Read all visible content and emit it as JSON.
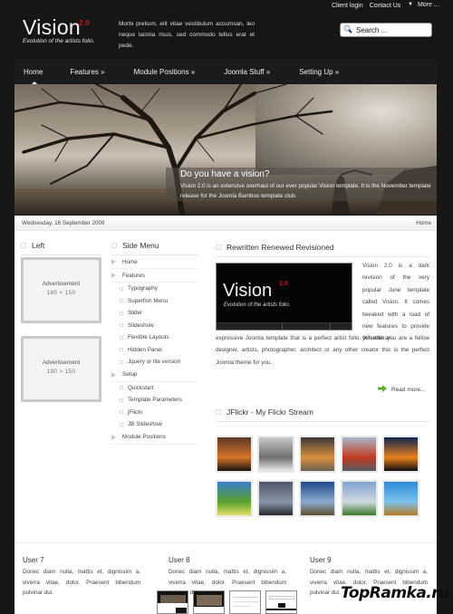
{
  "header": {
    "top_links": [
      "Client login",
      "Contact Us"
    ],
    "more_label": "More ...",
    "logo": {
      "name": "Vision",
      "version": "2.0",
      "tagline": "Evolution of the artists folio."
    },
    "intro": "Morbi pretium, elit vitae vestibulum accumsan, leo neque lacinia risus, sed commodo tellus erat et pede.",
    "search_placeholder": "Search ..."
  },
  "nav": {
    "items": [
      "Home",
      "Features »",
      "Module Positions »",
      "Joomla Stuff »",
      "Setting Up »"
    ],
    "active": "Home"
  },
  "hero": {
    "title": "Do you have a vision?",
    "text": "Vision 2.0 is an extensive overhaul of our ever popular Vision template. It is the November template release for the Joomla Bamboo template club."
  },
  "datebar": {
    "date": "Wednesday, 16 September 2009",
    "breadcrumb": "Home"
  },
  "left": {
    "title": "Left",
    "ads": [
      {
        "label": "Advertisement",
        "size": "180   ×   150"
      },
      {
        "label": "Advertisement",
        "size": "180   ×   150"
      }
    ]
  },
  "side_menu": {
    "title": "Side Menu",
    "items": [
      {
        "label": "Home",
        "level": 1
      },
      {
        "label": "Features",
        "level": 1
      },
      {
        "label": "Typography",
        "level": 2
      },
      {
        "label": "Superfish Menu",
        "level": 2
      },
      {
        "label": "Slider",
        "level": 2
      },
      {
        "label": "Slideshow",
        "level": 2
      },
      {
        "label": "Flexible Layouts",
        "level": 2
      },
      {
        "label": "Hidden Panel",
        "level": 2
      },
      {
        "label": "Jquery or lite version",
        "level": 2
      },
      {
        "label": "Setup",
        "level": 1
      },
      {
        "label": "Quickstart",
        "level": 2
      },
      {
        "label": "Template Parameters",
        "level": 2
      },
      {
        "label": "jFlickr",
        "level": 2
      },
      {
        "label": "JB Slideshow",
        "level": 2
      },
      {
        "label": "Module Positions",
        "level": 1
      }
    ]
  },
  "article": {
    "title": "Rewritten Renewed Revisioned",
    "image": {
      "name": "Vision",
      "version": "2.0",
      "tagline": "Evolution of the artists folio."
    },
    "side_text": "Vision 2.0 is a dark revision of the very popular June template called Vision. It comes tweaked with a load of new features to provide you with an",
    "full_text": "expressive Joomla template that is a perfect artist folio. Whether you are a fellow designer, artists, photographer, architect or any other creator this is the perfect Joomla theme for you.",
    "read_more": "Read more..."
  },
  "flickr": {
    "title": "JFlickr - My Flickr Stream",
    "thumbs": [
      {
        "name": "tree-silhouette-sunset",
        "colors": [
          "#5a3a24",
          "#d7742a",
          "#1a1410"
        ]
      },
      {
        "name": "bw-house",
        "colors": [
          "#c8c8c8",
          "#707070",
          "#e8e8e8"
        ]
      },
      {
        "name": "tree-light-sunset",
        "colors": [
          "#3a3836",
          "#d88f3e",
          "#6d5e4f"
        ]
      },
      {
        "name": "red-autumn-trees",
        "colors": [
          "#a9b6c9",
          "#c23a20",
          "#555a60"
        ]
      },
      {
        "name": "tree-orange-sunset",
        "colors": [
          "#0f2650",
          "#e7801c",
          "#101010"
        ]
      },
      {
        "name": "green-field-blue-sky",
        "colors": [
          "#3b7fd0",
          "#5a9f2a",
          "#e0e26a"
        ]
      },
      {
        "name": "stormy-tree",
        "colors": [
          "#505868",
          "#8a94a8",
          "#242830"
        ]
      },
      {
        "name": "bare-tree-blue-sky",
        "colors": [
          "#1e4a88",
          "#8aa9d0",
          "#5c5030"
        ]
      },
      {
        "name": "tree-meadow",
        "colors": [
          "#7fa3d0",
          "#d0d8e0",
          "#3b7a2b"
        ]
      },
      {
        "name": "bird-branch-sky",
        "colors": [
          "#2d8ad6",
          "#7dc3ee",
          "#b07a22"
        ]
      }
    ]
  },
  "users": [
    {
      "title": "User 7",
      "text": "Donec diam nulla, mattis et, dignissim a, viverra vitae, dolor. Praesent bibendum pulvinar dui."
    },
    {
      "title": "User 8",
      "text": "Donec diam nulla, mattis et, dignissim a, viverra vitae, dolor. Praesent bibendum pulvinar dui."
    },
    {
      "title": "User 9",
      "text": "Donec diam nulla, mattis et, dignissim a, viverra vitae, dolor. Praesent bibendum pulvinar dui."
    }
  ],
  "watermark": "TopRamka.ru",
  "colors": {
    "accent_red": "#c2161b",
    "background": "#161616",
    "nav_bg": "#1b1b1b",
    "readmore_arrow": "#58b030"
  }
}
